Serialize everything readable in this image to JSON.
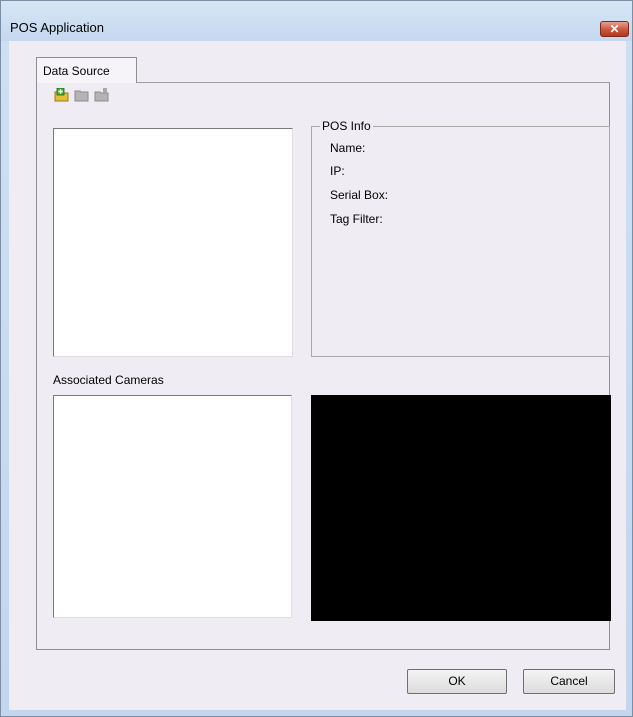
{
  "window": {
    "title": "POS Application",
    "close_label": "✕"
  },
  "tabs": [
    {
      "label": "Data Source",
      "selected": true
    }
  ],
  "toolbar": {
    "icons": [
      "add-folder-icon",
      "folder-icon",
      "remove-folder-icon"
    ]
  },
  "pos_info": {
    "legend": "POS Info",
    "fields": [
      "Name:",
      "IP:",
      "Serial Box:",
      "Tag Filter:"
    ]
  },
  "cameras": {
    "label": "Associated Cameras"
  },
  "buttons": {
    "ok": "OK",
    "cancel": "Cancel"
  },
  "colors": {
    "accent_close": "#c9553c",
    "preview_background": "#000000",
    "dialog_background": "#f0ecf3"
  }
}
